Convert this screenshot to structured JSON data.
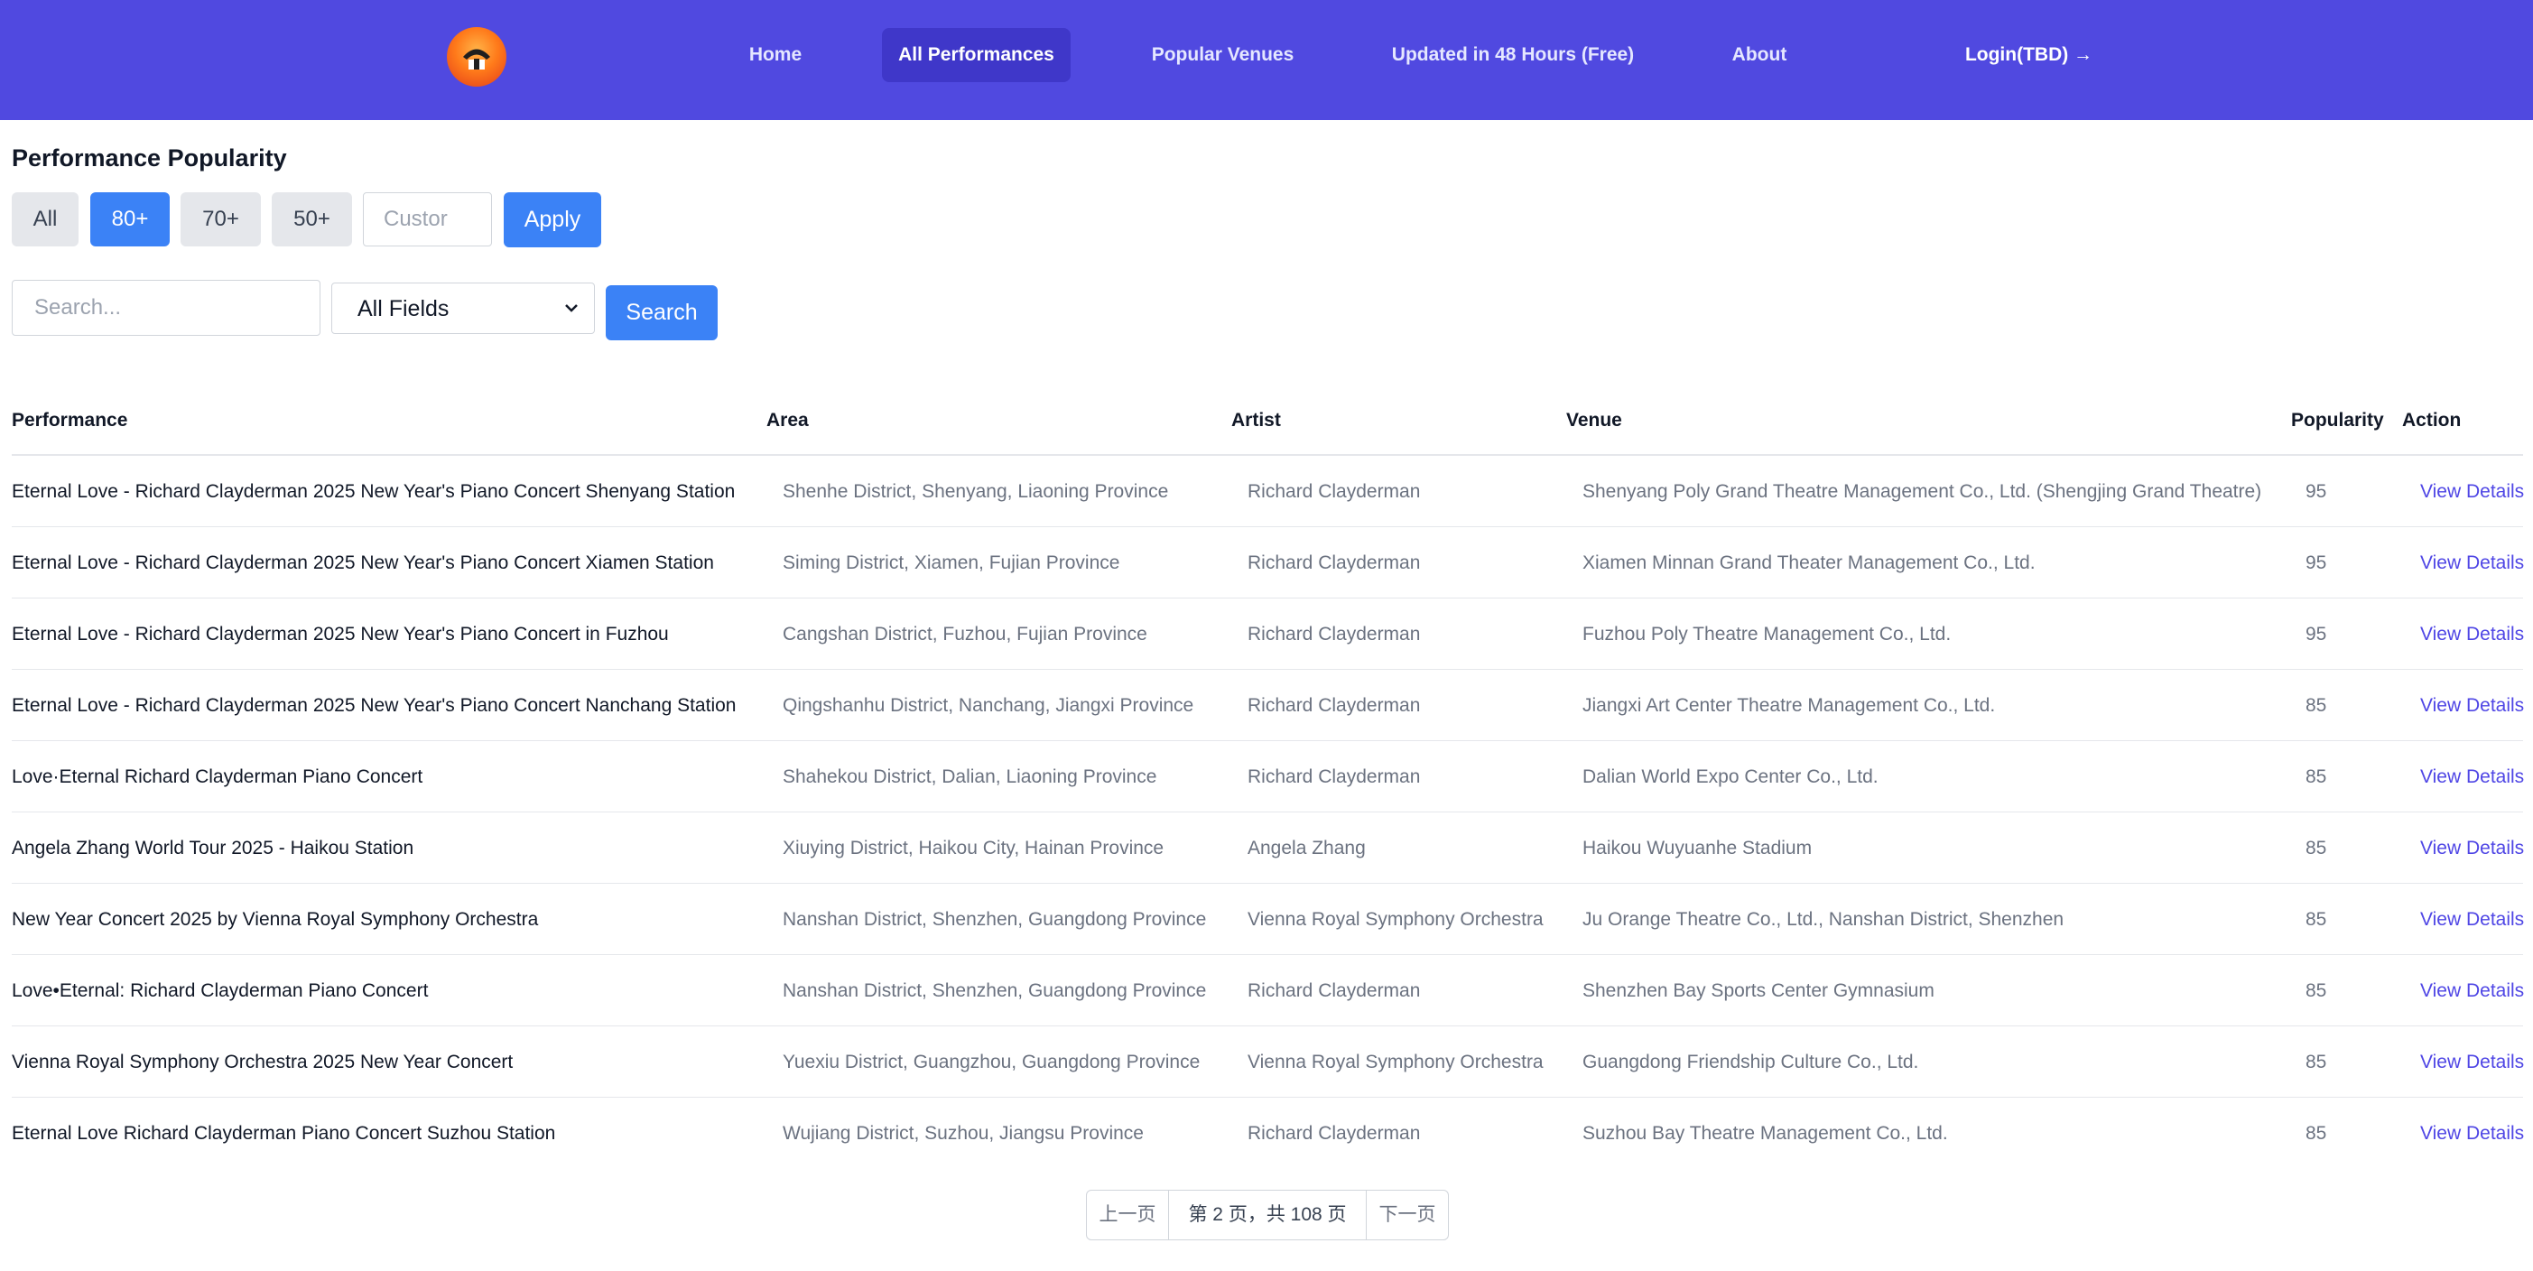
{
  "nav": {
    "items": [
      "Home",
      "All Performances",
      "Popular Venues",
      "Updated in 48 Hours (Free)",
      "About"
    ],
    "active": "All Performances",
    "login": "Login(TBD) →"
  },
  "filters": {
    "title": "Performance Popularity",
    "chips": [
      "All",
      "80+",
      "70+",
      "50+"
    ],
    "active_chip": "80+",
    "custom_placeholder": "Custor",
    "apply": "Apply"
  },
  "search": {
    "placeholder": "Search...",
    "field_select": "All Fields",
    "button": "Search"
  },
  "table": {
    "headers": [
      "Performance",
      "Area",
      "Artist",
      "Venue",
      "Popularity",
      "Action"
    ],
    "rows": [
      {
        "performance": "Eternal Love - Richard Clayderman 2025 New Year's Piano Concert Shenyang Station",
        "area": "Shenhe District, Shenyang, Liaoning Province",
        "artist": "Richard Clayderman",
        "venue": "Shenyang Poly Grand Theatre Management Co., Ltd. (Shengjing Grand Theatre)",
        "popularity": "95",
        "action": "View Details"
      },
      {
        "performance": "Eternal Love - Richard Clayderman 2025 New Year's Piano Concert Xiamen Station",
        "area": "Siming District, Xiamen, Fujian Province",
        "artist": "Richard Clayderman",
        "venue": "Xiamen Minnan Grand Theater Management Co., Ltd.",
        "popularity": "95",
        "action": "View Details"
      },
      {
        "performance": "Eternal Love - Richard Clayderman 2025 New Year's Piano Concert in Fuzhou",
        "area": "Cangshan District, Fuzhou, Fujian Province",
        "artist": "Richard Clayderman",
        "venue": "Fuzhou Poly Theatre Management Co., Ltd.",
        "popularity": "95",
        "action": "View Details"
      },
      {
        "performance": "Eternal Love - Richard Clayderman 2025 New Year's Piano Concert Nanchang Station",
        "area": "Qingshanhu District, Nanchang, Jiangxi Province",
        "artist": "Richard Clayderman",
        "venue": "Jiangxi Art Center Theatre Management Co., Ltd.",
        "popularity": "85",
        "action": "View Details"
      },
      {
        "performance": "Love·Eternal Richard Clayderman Piano Concert",
        "area": "Shahekou District, Dalian, Liaoning Province",
        "artist": "Richard Clayderman",
        "venue": "Dalian World Expo Center Co., Ltd.",
        "popularity": "85",
        "action": "View Details"
      },
      {
        "performance": "Angela Zhang World Tour 2025 - Haikou Station",
        "area": "Xiuying District, Haikou City, Hainan Province",
        "artist": "Angela Zhang",
        "venue": "Haikou Wuyuanhe Stadium",
        "popularity": "85",
        "action": "View Details"
      },
      {
        "performance": "New Year Concert 2025 by Vienna Royal Symphony Orchestra",
        "area": "Nanshan District, Shenzhen, Guangdong Province",
        "artist": "Vienna Royal Symphony Orchestra",
        "venue": "Ju Orange Theatre Co., Ltd., Nanshan District, Shenzhen",
        "popularity": "85",
        "action": "View Details"
      },
      {
        "performance": "Love•Eternal: Richard Clayderman Piano Concert",
        "area": "Nanshan District, Shenzhen, Guangdong Province",
        "artist": "Richard Clayderman",
        "venue": "Shenzhen Bay Sports Center Gymnasium",
        "popularity": "85",
        "action": "View Details"
      },
      {
        "performance": "Vienna Royal Symphony Orchestra 2025 New Year Concert",
        "area": "Yuexiu District, Guangzhou, Guangdong Province",
        "artist": "Vienna Royal Symphony Orchestra",
        "venue": "Guangdong Friendship Culture Co., Ltd.",
        "popularity": "85",
        "action": "View Details"
      },
      {
        "performance": "Eternal Love Richard Clayderman Piano Concert Suzhou Station",
        "area": "Wujiang District, Suzhou, Jiangsu Province",
        "artist": "Richard Clayderman",
        "venue": "Suzhou Bay Theatre Management Co., Ltd.",
        "popularity": "85",
        "action": "View Details"
      }
    ]
  },
  "pagination": {
    "prev": "上一页",
    "info": "第 2 页，共 108 页",
    "next": "下一页"
  },
  "colors": {
    "header_bg": "#5049e0",
    "nav_active_bg": "#3f37c9",
    "primary": "#3b82f6",
    "link": "#4f46e5"
  },
  "icons": {
    "logo": "logo-icon",
    "select_chevron": "chevron-down-icon"
  }
}
